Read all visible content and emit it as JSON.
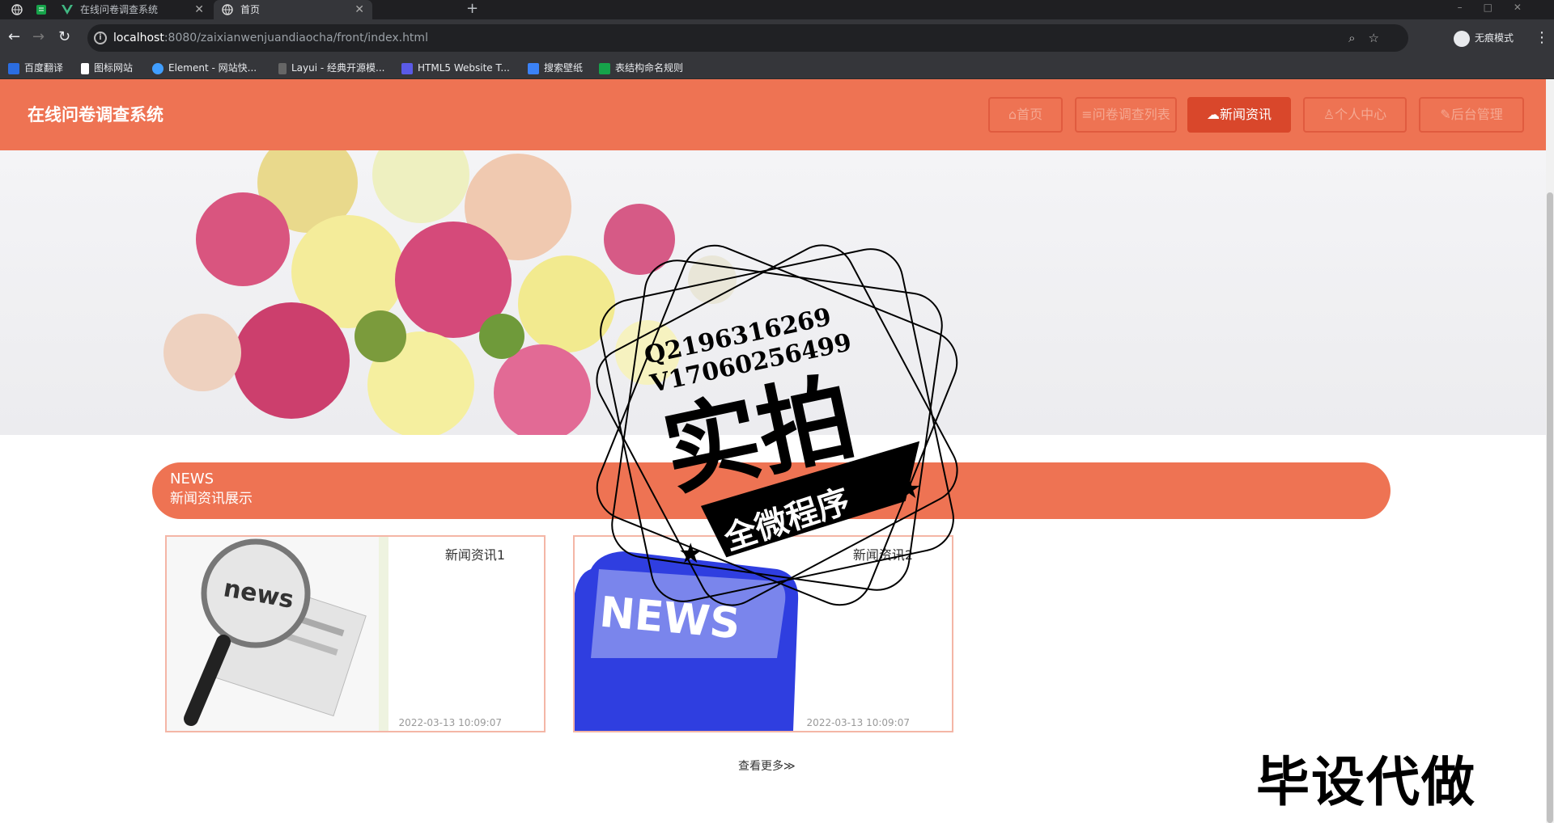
{
  "browser": {
    "tabs": [
      {
        "title": "",
        "icon": "globe-icon",
        "active": false
      },
      {
        "title": "",
        "icon": "sheet-icon",
        "active": false
      },
      {
        "title": "在线问卷调查系统",
        "icon": "vue-icon",
        "active": false
      },
      {
        "title": "首页",
        "icon": "globe-icon",
        "active": true
      }
    ],
    "new_tab": "+",
    "url_host": "localhost",
    "url_path": ":8080/zaixianwenjuandiaocha/front/index.html",
    "profile_label": "无痕模式",
    "bookmarks": [
      {
        "label": "百度翻译",
        "icon": "baidu-translate-icon"
      },
      {
        "label": "图标网站",
        "icon": "flag-icon"
      },
      {
        "label": "Element - 网站快...",
        "icon": "element-icon"
      },
      {
        "label": "Layui - 经典开源模...",
        "icon": "layui-icon"
      },
      {
        "label": "HTML5 Website T...",
        "icon": "html5-icon"
      },
      {
        "label": "搜索壁纸",
        "icon": "wallpaper-icon"
      },
      {
        "label": "表结构命名规则",
        "icon": "sheet-icon"
      }
    ]
  },
  "site": {
    "brand": "在线问卷调查系统",
    "nav": [
      {
        "label": "首页",
        "icon": "home-icon",
        "active": false
      },
      {
        "label": "问卷调查列表",
        "icon": "list-icon",
        "active": false
      },
      {
        "label": "新闻资讯",
        "icon": "news-icon",
        "active": true
      },
      {
        "label": "个人中心",
        "icon": "user-icon",
        "active": false
      },
      {
        "label": "后台管理",
        "icon": "wrench-icon",
        "active": false
      }
    ],
    "news_section": {
      "title_en": "NEWS",
      "title_cn": "新闻资讯展示"
    },
    "news_items": [
      {
        "title": "新闻资讯1",
        "date": "2022-03-13 10:09:07",
        "image": "magnifier-newspaper"
      },
      {
        "title": "新闻资讯2",
        "date": "2022-03-13 10:09:07",
        "image": "news-keyboard-key"
      }
    ],
    "more_label": "查看更多"
  },
  "overlay": {
    "stamp_line1": "Q2196316269",
    "stamp_line2": "V17060256499",
    "stamp_main": "实拍",
    "stamp_ribbon": "全微程序",
    "corner_watermark": "毕设代做"
  },
  "colors": {
    "accent": "#ee7353",
    "accent_dark": "#d9472b"
  }
}
